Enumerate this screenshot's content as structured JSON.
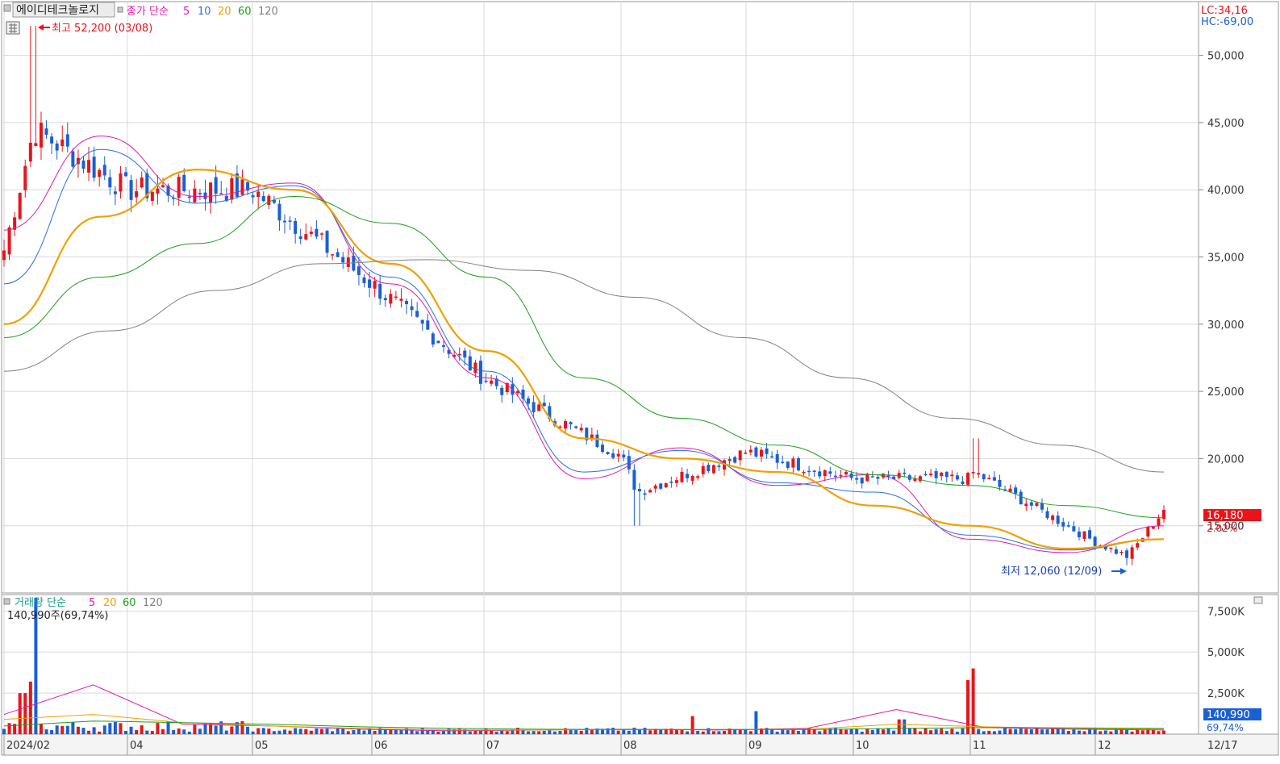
{
  "stock_name": "에이디테크놀로지",
  "price_legend": {
    "label": "종가 단순",
    "periods": [
      "5",
      "10",
      "20",
      "60",
      "120"
    ]
  },
  "volume_legend": {
    "label": "거래량 단순",
    "periods": [
      "5",
      "20",
      "60",
      "120"
    ]
  },
  "high_marker": "최고 52,200 (03/08)",
  "low_marker": "최저 12,060 (12/09)",
  "lc_label": "LC:34,16",
  "hc_label": "HC:-69,00",
  "current_price_label": "16,180",
  "current_change_label": "2.02%",
  "volume_info": "140,990주(69,74%)",
  "current_volume_label": "140,990",
  "current_volume_pct": "69,74%",
  "colors": {
    "up": "#e8141a",
    "down": "#1a5fd4",
    "ma5": "#e01aa8",
    "ma10": "#2a6fe0",
    "ma20": "#f0a000",
    "ma60": "#1aa01a",
    "ma120": "#808080"
  },
  "chart_data": [
    {
      "type": "candlestick",
      "title": "에이디테크놀로지",
      "xlabels": [
        "2024/02",
        "04",
        "05",
        "06",
        "07",
        "08",
        "09",
        "10",
        "11",
        "12",
        "12/17"
      ],
      "yticks": [
        "50,000",
        "45,000",
        "40,000",
        "35,000",
        "30,000",
        "25,000",
        "20,000",
        "15,000"
      ],
      "ylim": [
        10000,
        54000
      ],
      "anchors": [
        {
          "date": "2024/02",
          "close": 35500
        },
        {
          "date": "03/08",
          "close": 44500,
          "high": 52200
        },
        {
          "date": "04",
          "close": 40000
        },
        {
          "date": "05",
          "close": 40000
        },
        {
          "date": "06",
          "close": 33000
        },
        {
          "date": "07",
          "close": 26000
        },
        {
          "date": "08",
          "close": 20200
        },
        {
          "date": "08 low",
          "close": 17500
        },
        {
          "date": "09",
          "close": 20500
        },
        {
          "date": "10",
          "close": 18500
        },
        {
          "date": "11",
          "close": 18500
        },
        {
          "date": "11 high",
          "close": 19000,
          "high": 21500
        },
        {
          "date": "12",
          "close": 13800
        },
        {
          "date": "12/09",
          "close": 12700,
          "low": 12060
        },
        {
          "date": "12/17",
          "close": 16180
        }
      ],
      "series": [
        {
          "name": "5",
          "approx": [
            37000,
            44000,
            39500,
            40500,
            33000,
            26000,
            18500,
            20800,
            18000,
            18800,
            14000,
            13000,
            15000
          ]
        },
        {
          "name": "10",
          "approx": [
            33000,
            43000,
            39000,
            40300,
            33500,
            26500,
            19000,
            20600,
            18200,
            17500,
            14300,
            13200,
            14000
          ]
        },
        {
          "name": "20",
          "approx": [
            30000,
            38000,
            41500,
            40000,
            34500,
            28000,
            21500,
            20000,
            19000,
            16500,
            15000,
            13300,
            14000
          ]
        },
        {
          "name": "60",
          "approx": [
            29000,
            33500,
            36000,
            39500,
            37500,
            33500,
            26000,
            23000,
            21000,
            18800,
            18000,
            16500,
            15600
          ]
        },
        {
          "name": "120",
          "approx": [
            26500,
            29500,
            32500,
            34500,
            34800,
            34000,
            32000,
            29000,
            26000,
            23000,
            21000,
            19000
          ]
        }
      ]
    },
    {
      "type": "bar",
      "title": "거래량",
      "yticks": [
        "7,500K",
        "5,000K",
        "2,500K"
      ],
      "ylim": [
        0,
        8500
      ],
      "unit": "K",
      "spikes": [
        {
          "date": "02",
          "value": 8300
        },
        {
          "date": "02",
          "value": 3200
        },
        {
          "date": "02",
          "value": 2500
        },
        {
          "date": "08",
          "value": 1100
        },
        {
          "date": "09",
          "value": 1400
        },
        {
          "date": "10",
          "value": 900
        },
        {
          "date": "11",
          "value": 4000
        },
        {
          "date": "11",
          "value": 3300
        }
      ],
      "last": 140990
    }
  ]
}
